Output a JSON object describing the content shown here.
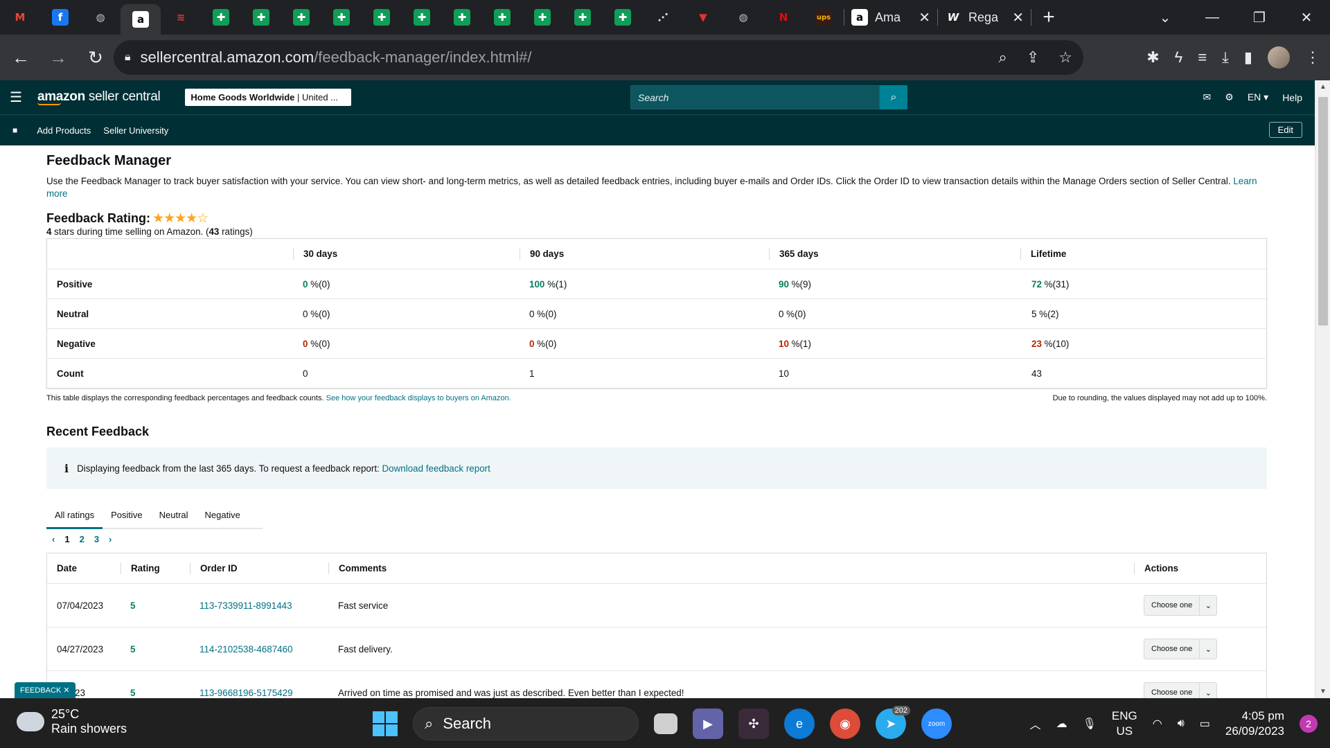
{
  "browser": {
    "pinned_tabs": [
      {
        "icon": "gmail-icon",
        "glyph": "M",
        "bg": "#202124",
        "fg": "#EA4335"
      },
      {
        "icon": "facebook-icon",
        "glyph": "f",
        "bg": "#1877F2",
        "fg": "#ffffff"
      },
      {
        "icon": "globe-icon",
        "glyph": "◍",
        "bg": "#202124",
        "fg": "#bdc1c6"
      },
      {
        "icon": "amazon-icon",
        "glyph": "a",
        "bg": "#ffffff",
        "fg": "#000000",
        "active": true
      },
      {
        "icon": "ebay-icon",
        "glyph": "≋",
        "bg": "#202124",
        "fg": "#e53238"
      },
      {
        "icon": "sheets-icon",
        "glyph": "✚",
        "bg": "#0F9D58",
        "fg": "#ffffff"
      },
      {
        "icon": "sheets-icon",
        "glyph": "✚",
        "bg": "#0F9D58",
        "fg": "#ffffff"
      },
      {
        "icon": "sheets-icon",
        "glyph": "✚",
        "bg": "#0F9D58",
        "fg": "#ffffff"
      },
      {
        "icon": "sheets-icon",
        "glyph": "✚",
        "bg": "#0F9D58",
        "fg": "#ffffff"
      },
      {
        "icon": "sheets-icon",
        "glyph": "✚",
        "bg": "#0F9D58",
        "fg": "#ffffff"
      },
      {
        "icon": "sheets-icon",
        "glyph": "✚",
        "bg": "#0F9D58",
        "fg": "#ffffff"
      },
      {
        "icon": "sheets-icon",
        "glyph": "✚",
        "bg": "#0F9D58",
        "fg": "#ffffff"
      },
      {
        "icon": "sheets-icon",
        "glyph": "✚",
        "bg": "#0F9D58",
        "fg": "#ffffff"
      },
      {
        "icon": "sheets-icon",
        "glyph": "✚",
        "bg": "#0F9D58",
        "fg": "#ffffff"
      },
      {
        "icon": "sheets-icon",
        "glyph": "✚",
        "bg": "#0F9D58",
        "fg": "#ffffff"
      },
      {
        "icon": "sheets-icon",
        "glyph": "✚",
        "bg": "#0F9D58",
        "fg": "#ffffff"
      },
      {
        "icon": "chart-icon",
        "glyph": "⋰",
        "bg": "#202124",
        "fg": "#e8eaed"
      },
      {
        "icon": "arrow-logo-icon",
        "glyph": "▼",
        "bg": "#202124",
        "fg": "#e53238"
      },
      {
        "icon": "globe-icon",
        "glyph": "◍",
        "bg": "#202124",
        "fg": "#bdc1c6"
      },
      {
        "icon": "netflix-icon",
        "glyph": "N",
        "bg": "#202124",
        "fg": "#E50914"
      },
      {
        "icon": "ups-icon",
        "glyph": "ups",
        "bg": "#351C15",
        "fg": "#FFB500"
      }
    ],
    "open_tabs": [
      {
        "title": "Ama",
        "glyph": "a",
        "bg": "#ffffff",
        "fg": "#000000"
      },
      {
        "title": "Rega",
        "glyph": "W",
        "bg": "#202124",
        "fg": "#ffffff"
      }
    ],
    "url_host": "sellercentral.amazon.com",
    "url_path": "/feedback-manager/index.html#/"
  },
  "header": {
    "logo_bold": "amazon",
    "logo_rest": " seller central",
    "store_name": "Home Goods Worldwide",
    "store_region": " | United ...",
    "search_placeholder": "Search",
    "language": "EN",
    "help": "Help",
    "nav_links": [
      "Add Products",
      "Seller University"
    ],
    "edit_label": "Edit"
  },
  "page": {
    "title": "Feedback Manager",
    "description": "Use the Feedback Manager to track buyer satisfaction with your service. You can view short- and long-term metrics, as well as detailed feedback entries, including buyer e-mails and Order IDs. Click the Order ID to view transaction details within the Manage Orders section of Seller Central.",
    "learn_more": "Learn more",
    "rating_title": "Feedback Rating:",
    "stars_filled": 4,
    "stars_total": 5,
    "rating_stars": "4",
    "rating_text_mid": " stars during time selling on Amazon. (",
    "rating_count": "43",
    "rating_text_end": " ratings)"
  },
  "metrics": {
    "columns": [
      "",
      "30 days",
      "90 days",
      "365 days",
      "Lifetime"
    ],
    "rows": [
      {
        "label": "Positive",
        "tone": "green",
        "cells": [
          [
            "0",
            " %(0)"
          ],
          [
            "100",
            " %(1)"
          ],
          [
            "90",
            " %(9)"
          ],
          [
            "72",
            " %(31)"
          ]
        ]
      },
      {
        "label": "Neutral",
        "tone": "gray",
        "cells": [
          [
            "0",
            " %(0)"
          ],
          [
            "0",
            " %(0)"
          ],
          [
            "0",
            " %(0)"
          ],
          [
            "5",
            " %(2)"
          ]
        ]
      },
      {
        "label": "Negative",
        "tone": "red",
        "cells": [
          [
            "0",
            " %(0)"
          ],
          [
            "0",
            " %(0)"
          ],
          [
            "10",
            " %(1)"
          ],
          [
            "23",
            " %(10)"
          ]
        ]
      },
      {
        "label": "Count",
        "tone": "gray",
        "cells": [
          [
            "0",
            ""
          ],
          [
            "1",
            ""
          ],
          [
            "10",
            ""
          ],
          [
            "43",
            ""
          ]
        ]
      }
    ],
    "note_left": "This table displays the corresponding feedback percentages and feedback counts.",
    "note_link": "See how your feedback displays to buyers on Amazon.",
    "note_right": "Due to rounding, the values displayed may not add up to 100%."
  },
  "recent": {
    "title": "Recent Feedback",
    "alert_text": "Displaying feedback from the last 365 days. To request a feedback report:",
    "alert_link": "Download feedback report",
    "tabs": [
      "All ratings",
      "Positive",
      "Neutral",
      "Negative"
    ],
    "selected_tab": 0,
    "pages": [
      "1",
      "2",
      "3"
    ],
    "current_page": "1",
    "columns": [
      "Date",
      "Rating",
      "Order ID",
      "Comments",
      "Actions"
    ],
    "rows": [
      {
        "date": "07/04/2023",
        "rating": "5",
        "order_id": "113-7339911-8991443",
        "comment": "Fast service",
        "action": "Choose one"
      },
      {
        "date": "04/27/2023",
        "rating": "5",
        "order_id": "114-2102538-4687460",
        "comment": "Fast delivery.",
        "action": "Choose one"
      },
      {
        "date": "9/2023",
        "rating": "5",
        "order_id": "113-9668196-5175429",
        "comment": "Arrived on time as promised and was just as described. Even better than I expected!",
        "action": "Choose one"
      }
    ],
    "feedback_tag": "FEEDBACK"
  },
  "taskbar": {
    "temperature": "25°C",
    "weather": "Rain showers",
    "search_label": "Search",
    "telegram_badge": "202",
    "zoom_label": "zoom",
    "lang_top": "ENG",
    "lang_bottom": "US",
    "time": "4:05 pm",
    "date": "26/09/2023",
    "notification_count": "2"
  }
}
